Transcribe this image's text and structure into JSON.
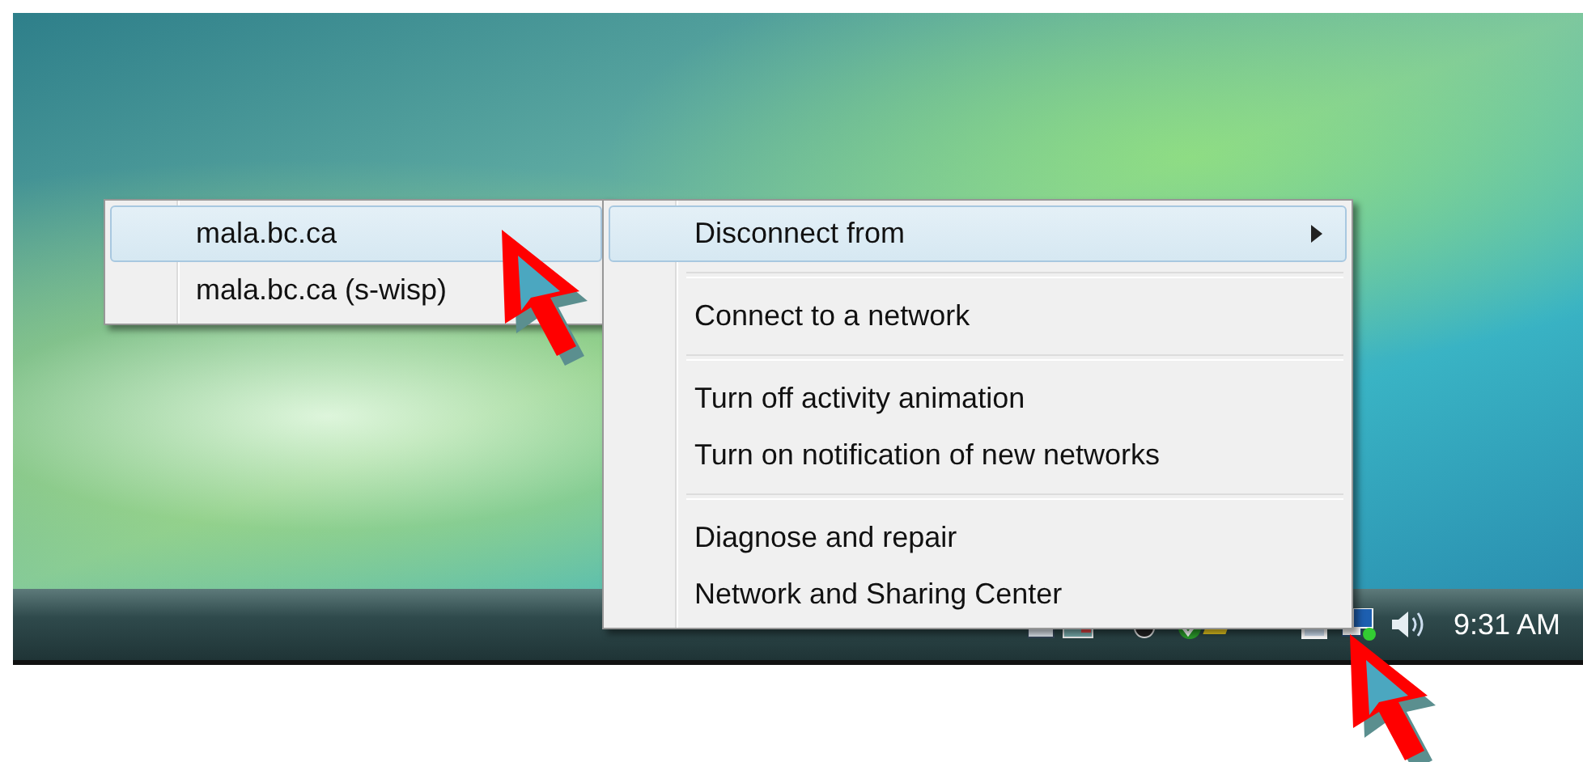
{
  "submenu": {
    "items": [
      {
        "label": "mala.bc.ca",
        "selected": true
      },
      {
        "label": "mala.bc.ca (s-wisp)",
        "selected": false
      }
    ]
  },
  "menu": {
    "groups": [
      [
        {
          "label": "Disconnect from",
          "kind": "submenu",
          "selected": true
        }
      ],
      [
        {
          "label": "Connect to a network",
          "kind": "action",
          "selected": false
        }
      ],
      [
        {
          "label": "Turn off activity animation",
          "kind": "action",
          "selected": false
        },
        {
          "label": "Turn on notification of new networks",
          "kind": "action",
          "selected": false
        }
      ],
      [
        {
          "label": "Diagnose and repair",
          "kind": "action",
          "selected": false
        },
        {
          "label": "Network and Sharing Center",
          "kind": "action",
          "selected": false
        }
      ]
    ]
  },
  "taskbar": {
    "clock": "9:31 AM"
  }
}
